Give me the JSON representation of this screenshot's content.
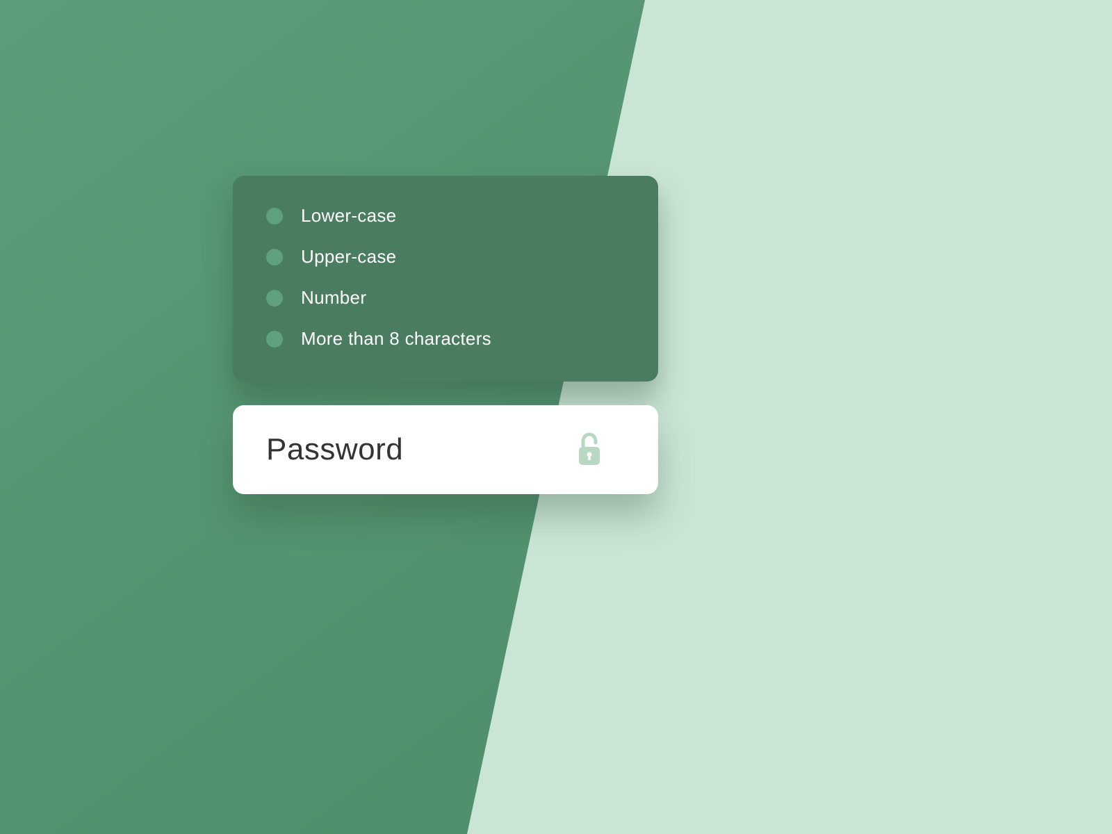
{
  "colors": {
    "bg_light": "#cbe5d5",
    "bg_dark": "#4a8a67",
    "card_bg": "#4a7c5f",
    "bullet": "#5fa17f",
    "text_white": "#ffffff",
    "text_dark": "#333333",
    "icon": "#b9d8c4"
  },
  "requirements": [
    {
      "label": "Lower-case"
    },
    {
      "label": "Upper-case"
    },
    {
      "label": "Number"
    },
    {
      "label": "More than 8 characters"
    }
  ],
  "password_field": {
    "placeholder": "Password",
    "value": ""
  }
}
